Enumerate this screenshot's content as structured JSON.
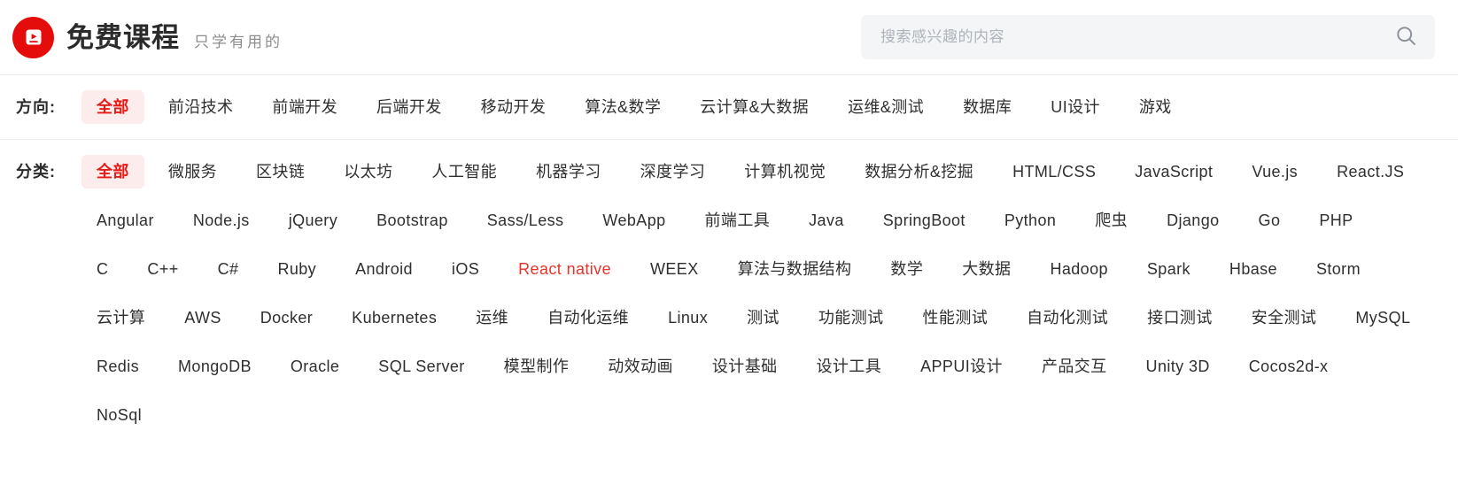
{
  "header": {
    "logo_icon": "video-book-icon",
    "logo_color": "#e50c0c",
    "title": "免费课程",
    "subtitle": "只学有用的",
    "search": {
      "placeholder": "搜索感兴趣的内容",
      "value": "",
      "icon": "search-icon"
    }
  },
  "filters": [
    {
      "label": "方向:",
      "key": "direction",
      "rows": [
        [
          {
            "label": "全部",
            "state": "active"
          },
          {
            "label": "前沿技术",
            "state": "normal"
          },
          {
            "label": "前端开发",
            "state": "normal"
          },
          {
            "label": "后端开发",
            "state": "normal"
          },
          {
            "label": "移动开发",
            "state": "normal"
          },
          {
            "label": "算法&数学",
            "state": "normal"
          },
          {
            "label": "云计算&大数据",
            "state": "normal"
          },
          {
            "label": "运维&测试",
            "state": "normal"
          },
          {
            "label": "数据库",
            "state": "normal"
          },
          {
            "label": "UI设计",
            "state": "normal"
          },
          {
            "label": "游戏",
            "state": "normal"
          }
        ]
      ]
    },
    {
      "label": "分类:",
      "key": "category",
      "rows": [
        [
          {
            "label": "全部",
            "state": "active"
          },
          {
            "label": "微服务",
            "state": "normal"
          },
          {
            "label": "区块链",
            "state": "normal"
          },
          {
            "label": "以太坊",
            "state": "normal"
          },
          {
            "label": "人工智能",
            "state": "normal"
          },
          {
            "label": "机器学习",
            "state": "normal"
          },
          {
            "label": "深度学习",
            "state": "normal"
          },
          {
            "label": "计算机视觉",
            "state": "normal"
          },
          {
            "label": "数据分析&挖掘",
            "state": "normal"
          },
          {
            "label": "HTML/CSS",
            "state": "normal"
          },
          {
            "label": "JavaScript",
            "state": "normal"
          },
          {
            "label": "Vue.js",
            "state": "normal"
          },
          {
            "label": "React.JS",
            "state": "normal"
          }
        ],
        [
          {
            "label": "Angular",
            "state": "normal"
          },
          {
            "label": "Node.js",
            "state": "normal"
          },
          {
            "label": "jQuery",
            "state": "normal"
          },
          {
            "label": "Bootstrap",
            "state": "normal"
          },
          {
            "label": "Sass/Less",
            "state": "normal"
          },
          {
            "label": "WebApp",
            "state": "normal"
          },
          {
            "label": "前端工具",
            "state": "normal"
          },
          {
            "label": "Java",
            "state": "normal"
          },
          {
            "label": "SpringBoot",
            "state": "normal"
          },
          {
            "label": "Python",
            "state": "normal"
          },
          {
            "label": "爬虫",
            "state": "normal"
          },
          {
            "label": "Django",
            "state": "normal"
          },
          {
            "label": "Go",
            "state": "normal"
          },
          {
            "label": "PHP",
            "state": "normal"
          }
        ],
        [
          {
            "label": "C",
            "state": "normal"
          },
          {
            "label": "C++",
            "state": "normal"
          },
          {
            "label": "C#",
            "state": "normal"
          },
          {
            "label": "Ruby",
            "state": "normal"
          },
          {
            "label": "Android",
            "state": "normal"
          },
          {
            "label": "iOS",
            "state": "normal"
          },
          {
            "label": "React native",
            "state": "highlight"
          },
          {
            "label": "WEEX",
            "state": "normal"
          },
          {
            "label": "算法与数据结构",
            "state": "normal"
          },
          {
            "label": "数学",
            "state": "normal"
          },
          {
            "label": "大数据",
            "state": "normal"
          },
          {
            "label": "Hadoop",
            "state": "normal"
          },
          {
            "label": "Spark",
            "state": "normal"
          },
          {
            "label": "Hbase",
            "state": "normal"
          },
          {
            "label": "Storm",
            "state": "normal"
          }
        ],
        [
          {
            "label": "云计算",
            "state": "normal"
          },
          {
            "label": "AWS",
            "state": "normal"
          },
          {
            "label": "Docker",
            "state": "normal"
          },
          {
            "label": "Kubernetes",
            "state": "normal"
          },
          {
            "label": "运维",
            "state": "normal"
          },
          {
            "label": "自动化运维",
            "state": "normal"
          },
          {
            "label": "Linux",
            "state": "normal"
          },
          {
            "label": "测试",
            "state": "normal"
          },
          {
            "label": "功能测试",
            "state": "normal"
          },
          {
            "label": "性能测试",
            "state": "normal"
          },
          {
            "label": "自动化测试",
            "state": "normal"
          },
          {
            "label": "接口测试",
            "state": "normal"
          },
          {
            "label": "安全测试",
            "state": "normal"
          },
          {
            "label": "MySQL",
            "state": "normal"
          }
        ],
        [
          {
            "label": "Redis",
            "state": "normal"
          },
          {
            "label": "MongoDB",
            "state": "normal"
          },
          {
            "label": "Oracle",
            "state": "normal"
          },
          {
            "label": "SQL Server",
            "state": "normal"
          },
          {
            "label": "模型制作",
            "state": "normal"
          },
          {
            "label": "动效动画",
            "state": "normal"
          },
          {
            "label": "设计基础",
            "state": "normal"
          },
          {
            "label": "设计工具",
            "state": "normal"
          },
          {
            "label": "APPUI设计",
            "state": "normal"
          },
          {
            "label": "产品交互",
            "state": "normal"
          },
          {
            "label": "Unity 3D",
            "state": "normal"
          },
          {
            "label": "Cocos2d-x",
            "state": "normal"
          }
        ],
        [
          {
            "label": "NoSql",
            "state": "normal"
          }
        ]
      ]
    }
  ],
  "colors": {
    "brand_red": "#e50c0c",
    "accent_red": "#e51b17",
    "active_chip_bg": "#fdecec",
    "search_bg": "#f4f5f7",
    "divider": "#ececec"
  }
}
